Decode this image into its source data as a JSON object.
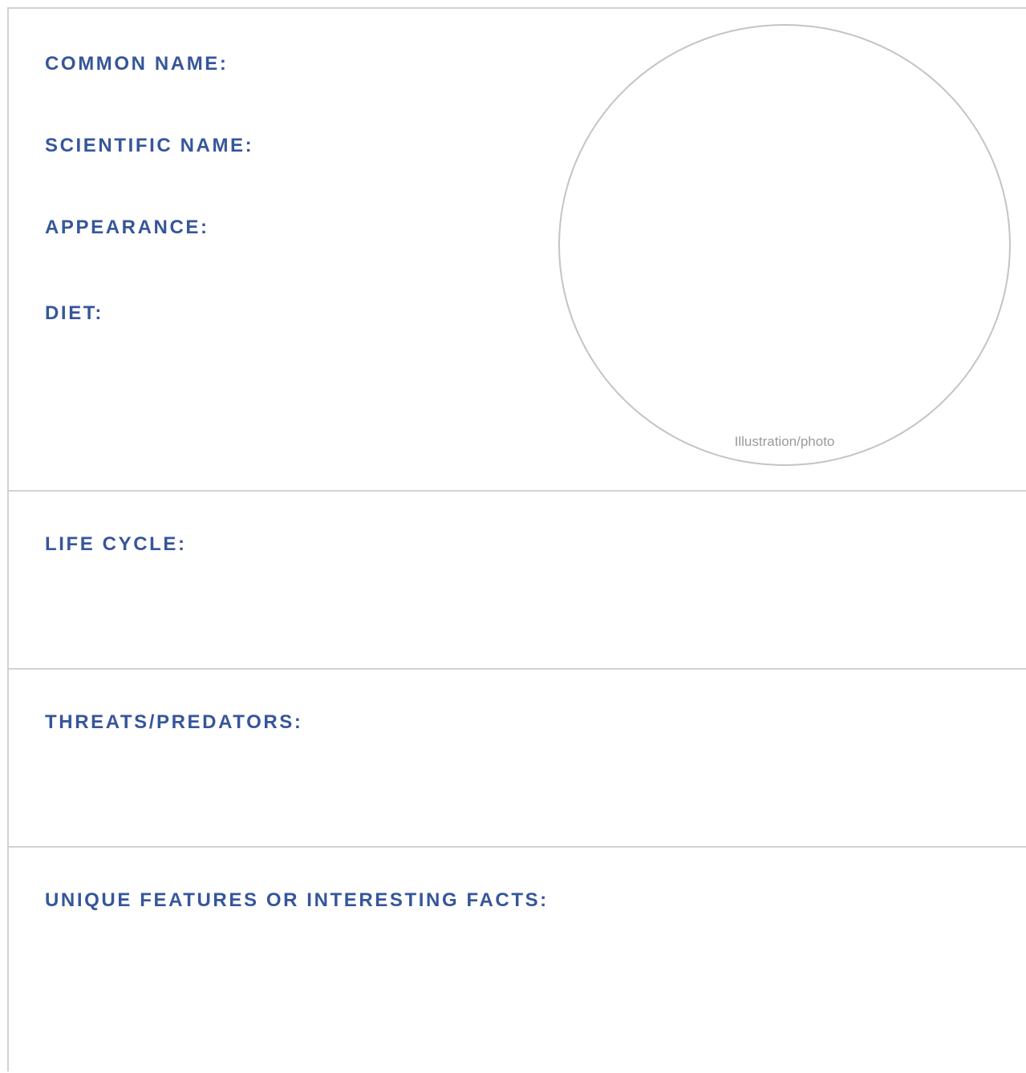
{
  "top_section": {
    "common_name_label": "COMMON NAME:",
    "scientific_name_label": "SCIENTIFIC NAME:",
    "appearance_label": "APPEARANCE:",
    "diet_label": "DIET:",
    "photo_caption": "Illustration/photo"
  },
  "life_cycle_label": "LIFE CYCLE:",
  "threats_label": "THREATS/PREDATORS:",
  "unique_label": "UNIQUE FEATURES OR INTERESTING FACTS:",
  "colors": {
    "heading": "#36569a",
    "rule": "#d2d2d2",
    "circle": "#c4c4c4",
    "caption": "#9a9a9a"
  }
}
